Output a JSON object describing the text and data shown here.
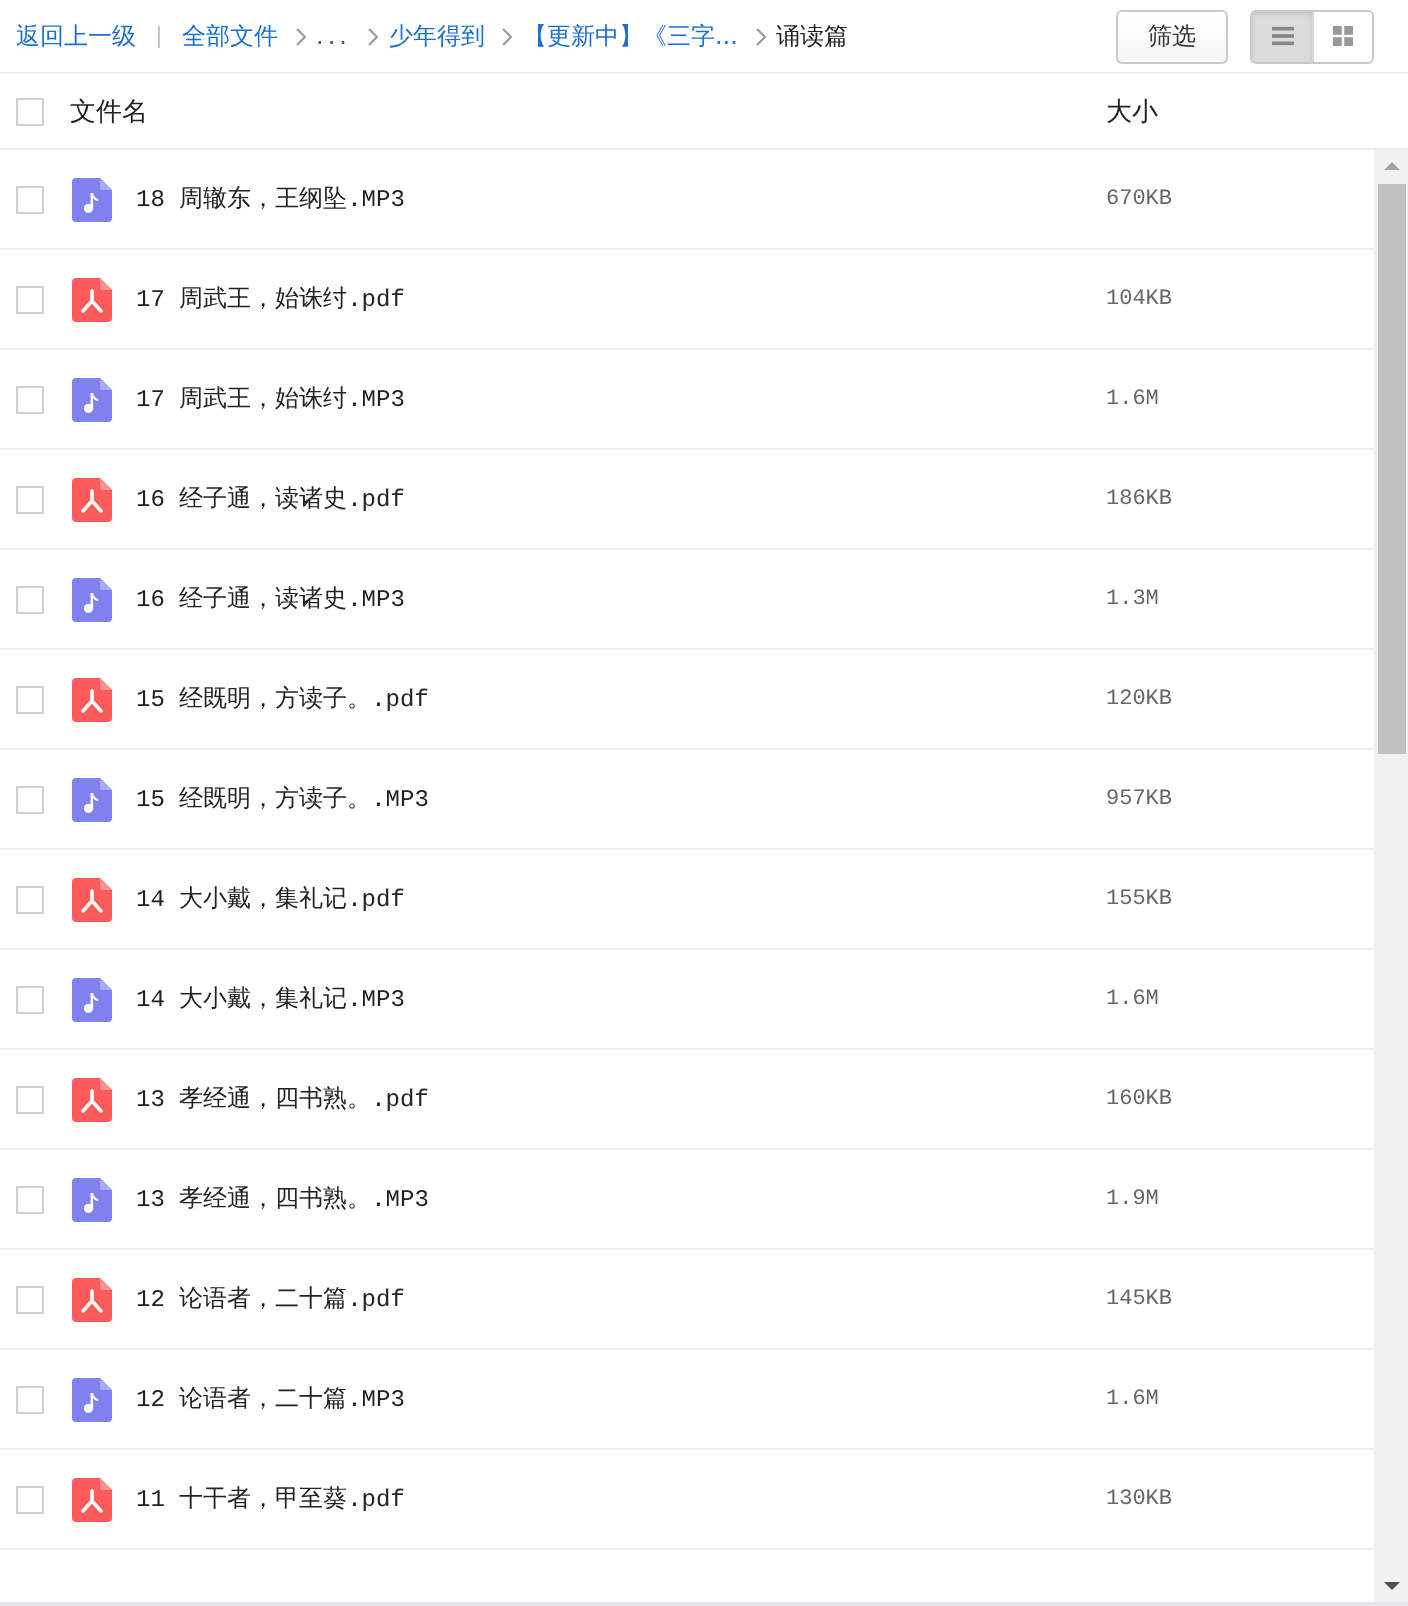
{
  "toolbar": {
    "back_link": "返回上一级",
    "breadcrumbs": [
      {
        "label": "全部文件",
        "kind": "link"
      },
      {
        "label": "...",
        "kind": "ellipsis"
      },
      {
        "label": "少年得到",
        "kind": "link"
      },
      {
        "label": "【更新中】《三字...",
        "kind": "link"
      },
      {
        "label": "诵读篇",
        "kind": "current"
      }
    ],
    "filter_button": "筛选",
    "view_modes": [
      {
        "kind": "list",
        "selected": true
      },
      {
        "kind": "grid",
        "selected": false
      }
    ]
  },
  "table": {
    "select_all": {
      "checked": false
    },
    "columns": [
      "文件名",
      "大小"
    ],
    "rows": [
      {
        "kind": "audio",
        "name": "18 周辙东，王纲坠.MP3",
        "size": "670KB",
        "checked": false
      },
      {
        "kind": "pdf",
        "name": "17 周武王，始诛纣.pdf",
        "size": "104KB",
        "checked": false
      },
      {
        "kind": "audio",
        "name": "17 周武王，始诛纣.MP3",
        "size": "1.6M",
        "checked": false
      },
      {
        "kind": "pdf",
        "name": "16 经子通，读诸史.pdf",
        "size": "186KB",
        "checked": false
      },
      {
        "kind": "audio",
        "name": "16 经子通，读诸史.MP3",
        "size": "1.3M",
        "checked": false
      },
      {
        "kind": "pdf",
        "name": "15 经既明，方读子。.pdf",
        "size": "120KB",
        "checked": false
      },
      {
        "kind": "audio",
        "name": "15 经既明，方读子。.MP3",
        "size": "957KB",
        "checked": false
      },
      {
        "kind": "pdf",
        "name": "14 大小戴，集礼记.pdf",
        "size": "155KB",
        "checked": false
      },
      {
        "kind": "audio",
        "name": "14 大小戴，集礼记.MP3",
        "size": "1.6M",
        "checked": false
      },
      {
        "kind": "pdf",
        "name": "13 孝经通，四书熟。.pdf",
        "size": "160KB",
        "checked": false
      },
      {
        "kind": "audio",
        "name": "13 孝经通，四书熟。.MP3",
        "size": "1.9M",
        "checked": false
      },
      {
        "kind": "pdf",
        "name": "12 论语者，二十篇.pdf",
        "size": "145KB",
        "checked": false
      },
      {
        "kind": "audio",
        "name": "12 论语者，二十篇.MP3",
        "size": "1.6M",
        "checked": false
      },
      {
        "kind": "pdf",
        "name": "11 十干者，甲至葵.pdf",
        "size": "130KB",
        "checked": false
      }
    ]
  }
}
